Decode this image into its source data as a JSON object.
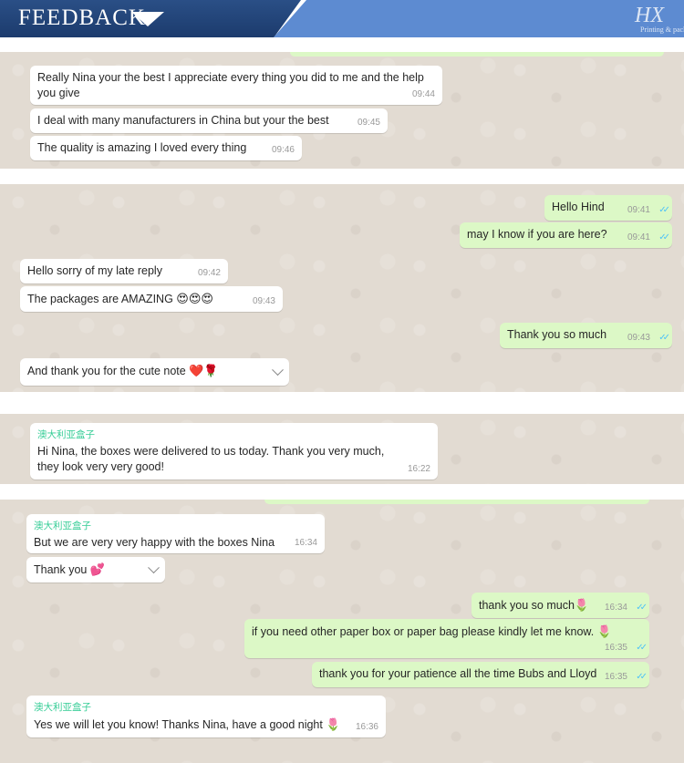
{
  "header": {
    "title": "FEEDBACK",
    "logo": "HX",
    "logo_sub": "Printing & packaging"
  },
  "panel1": [
    {
      "text": "Really Nina your the best I appreciate every thing you did to me and the help you give",
      "time": "09:44"
    },
    {
      "text": "I deal with many manufacturers in China but your the best",
      "time": "09:45"
    },
    {
      "text": "The quality is amazing I loved every thing",
      "time": "09:46"
    }
  ],
  "panel2": [
    {
      "text": "Hello Hind",
      "time": "09:41",
      "dir": "out"
    },
    {
      "text": "may I know if you are here?",
      "time": "09:41",
      "dir": "out"
    },
    {
      "text": "Hello sorry of my late reply",
      "time": "09:42",
      "dir": "in"
    },
    {
      "text": "The packages are AMAZING",
      "emoji": "😍😍😍",
      "time": "09:43",
      "dir": "in"
    },
    {
      "text": "Thank you so much",
      "time": "09:43",
      "dir": "out"
    },
    {
      "text": "And thank you for the cute note",
      "emoji": "❤️🌹",
      "dir": "in"
    }
  ],
  "panel3": {
    "sender": "澳大利亚盒子",
    "text": "Hi Nina, the boxes were delivered to us today. Thank you very much, they look very very good!",
    "time": "16:22"
  },
  "panel4": [
    {
      "sender": "澳大利亚盒子",
      "text": "But we are very very happy with the boxes Nina",
      "time": "16:34",
      "dir": "in"
    },
    {
      "text": "Thank you",
      "emoji": "💕",
      "dir": "in"
    },
    {
      "text": "thank you so much",
      "emoji": "🌷",
      "time": "16:34",
      "dir": "out"
    },
    {
      "text": "if you need other paper box or paper bag please kindly let me know.",
      "emoji": "🌷",
      "time": "16:35",
      "dir": "out"
    },
    {
      "text": "thank you for your patience all the time Bubs and Lloyd",
      "time": "16:35",
      "dir": "out"
    },
    {
      "sender": "澳大利亚盒子",
      "text": "Yes we will let you know! Thanks Nina, have a good night",
      "emoji": "🌷",
      "time": "16:36",
      "dir": "in"
    }
  ],
  "icons": {
    "ticks": "double-check-icon",
    "chevron": "chevron-down-icon"
  },
  "colors": {
    "header_dark": "#1c3b6d",
    "header_band": "#5d8bd1",
    "outgoing": "#dcf8c6",
    "incoming": "#ffffff",
    "sender": "#35cd96",
    "ticks": "#4fc3f7"
  }
}
